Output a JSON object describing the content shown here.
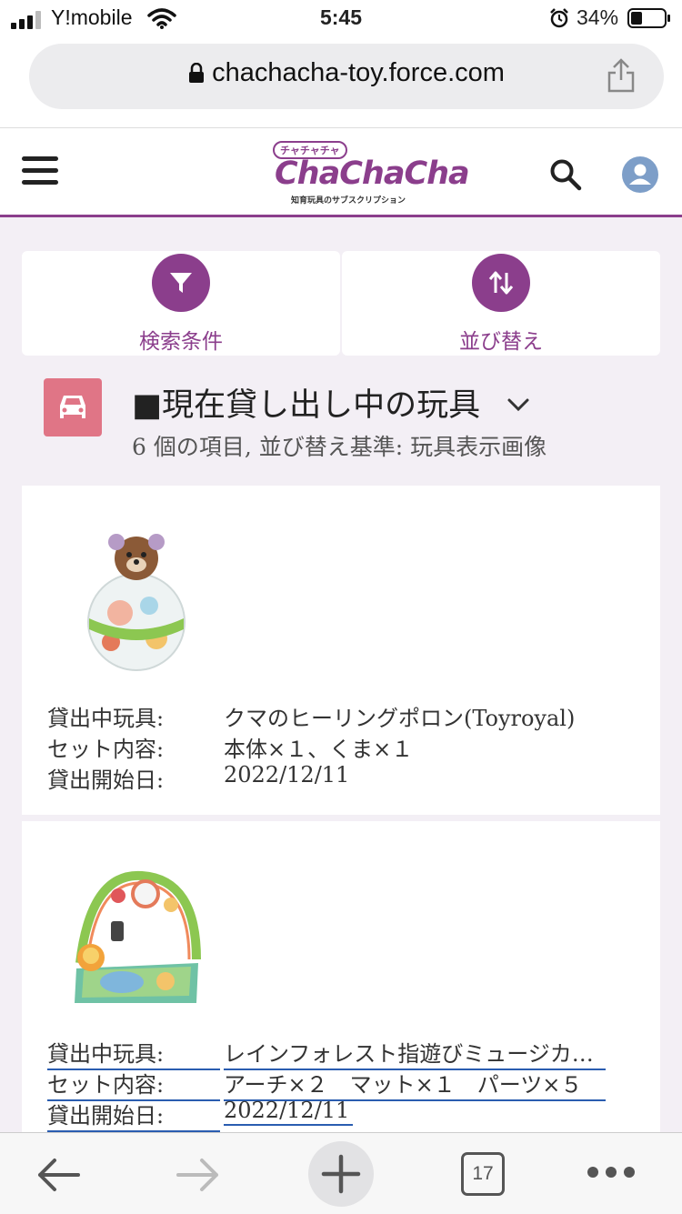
{
  "status": {
    "carrier": "Y!mobile",
    "time": "5:45",
    "battery": "34%"
  },
  "url": "chachacha-toy.force.com",
  "header": {
    "logo_top": "チャチャチャ",
    "logo_main": "ChaChaCha",
    "logo_sub": "知育玩具のサブスクリプション"
  },
  "buttons": {
    "filter_label": "検索条件",
    "sort_label": "並び替え"
  },
  "list": {
    "title": "■現在貸し出し中の玩具",
    "meta": "6 個の項目, 並び替え基準: 玩具表示画像"
  },
  "fields": {
    "toy": "貸出中玩具:",
    "set": "セット内容:",
    "start": "貸出開始日:"
  },
  "items": [
    {
      "toy": "クマのヒーリングポロン(Toyroyal)",
      "set": "本体×１、くま×１",
      "start": "2022/12/11"
    },
    {
      "toy": "レインフォレスト指遊びミュージカ…",
      "set": "アーチ×２　マット×１　パーツ×５",
      "start": "2022/12/11"
    }
  ],
  "tabs_count": "17",
  "colors": {
    "brand": "#8b3e8c",
    "icon_bg": "#e07586",
    "link": "#2a5db0"
  }
}
